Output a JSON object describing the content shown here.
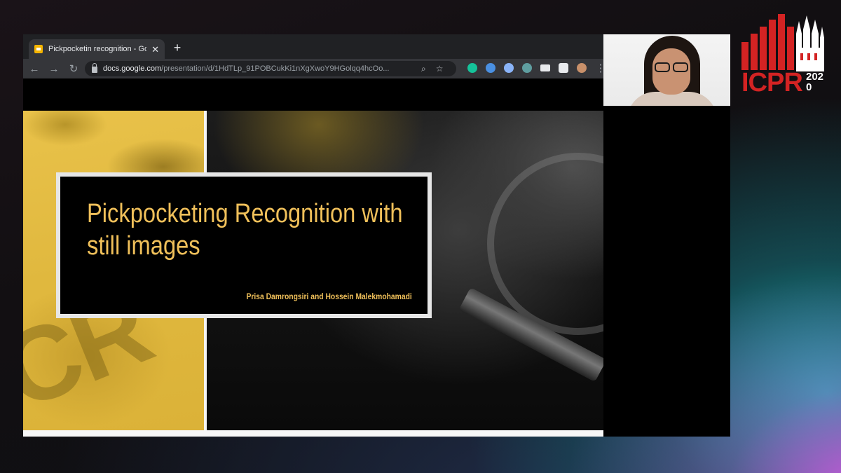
{
  "browser": {
    "tab": {
      "title": "Pickpocketin recognition - Goo",
      "close": "✕"
    },
    "new_tab": "+",
    "nav": {
      "back": "←",
      "forward": "→",
      "reload": "↻"
    },
    "url": {
      "domain": "docs.google.com",
      "path": "/presentation/d/1HdTLp_91POBCukKi1nXgXwoY9HGolqq4hcOo..."
    },
    "omnibox_icons": {
      "zoom": "⌕",
      "bookmark": "☆"
    },
    "extensions": [
      {
        "name": "grammarly-icon",
        "color": "#15c39a"
      },
      {
        "name": "extension-blue-icon",
        "color": "#4a90e2"
      },
      {
        "name": "extension-people-icon",
        "color": "#8ab4f8"
      },
      {
        "name": "extension-globe-icon",
        "color": "#5f9ea0"
      },
      {
        "name": "extension-screen-icon",
        "color": "#e8eaed"
      },
      {
        "name": "puzzle-icon",
        "color": "#e8eaed"
      },
      {
        "name": "profile-avatar-icon",
        "color": "#c8906a"
      }
    ],
    "menu": "⋮"
  },
  "slide": {
    "title": "Pickpocketing Recognition with still images",
    "title_line1": "Pickpocketing Recognition with",
    "title_line2": "still images",
    "authors": "Prisa Damrongsiri and Hossein Malekmohamadi",
    "accent_color": "#f0c05a"
  },
  "logo": {
    "text": "ICPR",
    "year": "2020",
    "color": "#d32323"
  }
}
